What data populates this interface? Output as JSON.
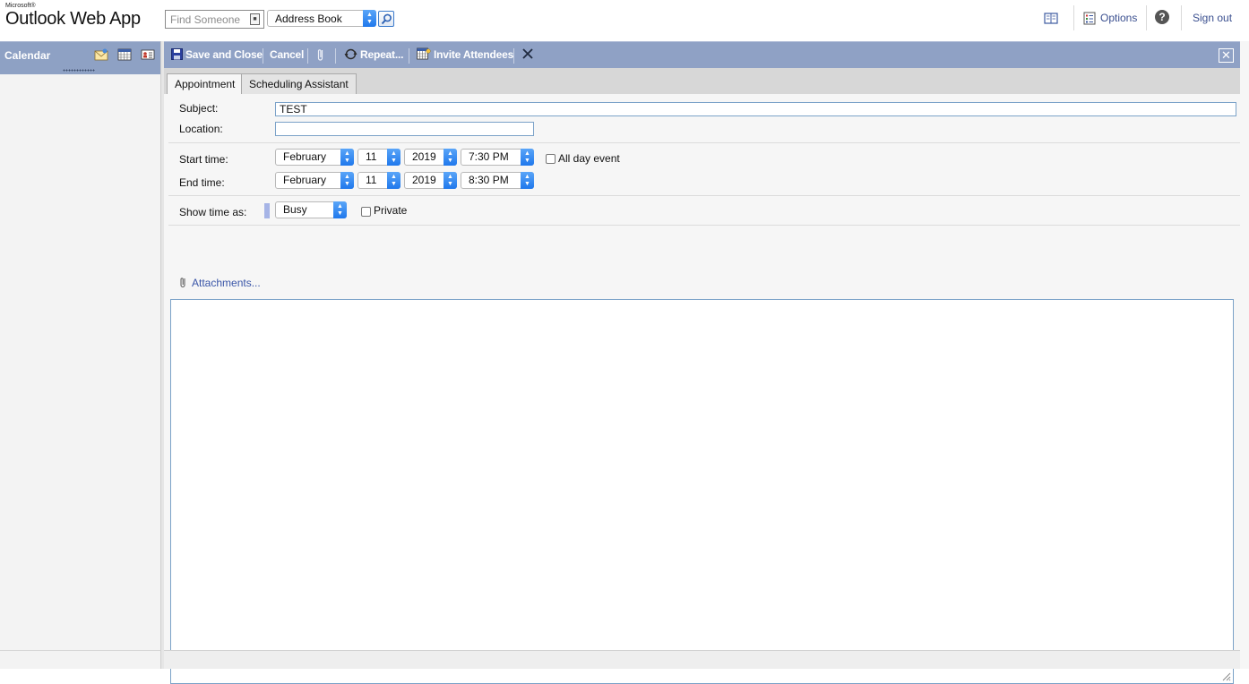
{
  "header": {
    "brand_small": "Microsoft®",
    "brand": "Outlook Web App",
    "find_placeholder": "Find Someone",
    "address_book": "Address Book",
    "options": "Options",
    "sign_out": "Sign out",
    "help_glyph": "?"
  },
  "leftnav": {
    "title": "Calendar"
  },
  "toolbar": {
    "save_close": "Save and Close",
    "cancel": "Cancel",
    "repeat": "Repeat...",
    "invite": "Invite Attendees"
  },
  "tabs": [
    {
      "label": "Appointment",
      "active": true
    },
    {
      "label": "Scheduling Assistant",
      "active": false
    }
  ],
  "form": {
    "subject_label": "Subject:",
    "subject_value": "TEST",
    "location_label": "Location:",
    "location_value": "",
    "start_label": "Start time:",
    "end_label": "End time:",
    "start": {
      "month": "February",
      "day": "11",
      "year": "2019",
      "time": "7:30 PM"
    },
    "end": {
      "month": "February",
      "day": "11",
      "year": "2019",
      "time": "8:30 PM"
    },
    "all_day_label": "All day event",
    "show_as_label": "Show time as:",
    "show_as_value": "Busy",
    "private_label": "Private",
    "attachments_label": "Attachments..."
  },
  "icons": {
    "address_book": "address-book-icon",
    "options": "options-icon",
    "help": "help-icon",
    "save": "save-disk-icon",
    "attach": "paperclip-icon",
    "repeat": "repeat-icon",
    "invite": "invite-attendees-icon",
    "delete": "delete-x-icon",
    "close": "close-icon"
  },
  "colors": {
    "toolbar_bg": "#8fa1c5",
    "link": "#3a4f8f",
    "spinner": "#1f78ec",
    "busy": "#a6b4e6"
  }
}
